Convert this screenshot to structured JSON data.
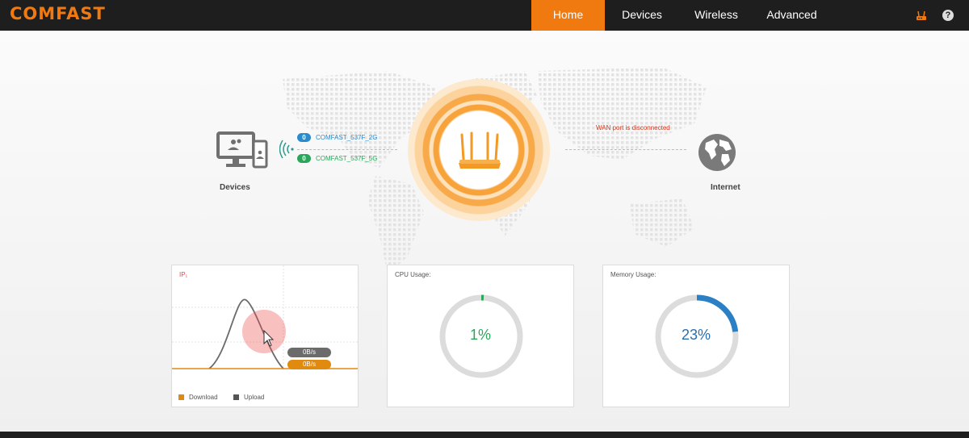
{
  "brand": {
    "logo_text": "COMFAST",
    "accent": "#f07a0f"
  },
  "nav": {
    "items": [
      {
        "label": "Home",
        "active": true
      },
      {
        "label": "Devices",
        "active": false
      },
      {
        "label": "Wireless",
        "active": false
      },
      {
        "label": "Advanced",
        "active": false
      }
    ],
    "icons": [
      "router-status-icon",
      "help-icon"
    ],
    "help_glyph": "?"
  },
  "topology": {
    "devices_label": "Devices",
    "ssids": [
      {
        "count": "0",
        "name": "COMFAST_537F_2G",
        "color": "#2b8acb"
      },
      {
        "count": "0",
        "name": "COMFAST_537F_5G",
        "color": "#2aa55a"
      }
    ],
    "wan_status": "WAN port is disconnected",
    "internet_label": "Internet"
  },
  "traffic": {
    "title": "IP₁",
    "upload_rate": "0B/s",
    "download_rate": "0B/s",
    "legend": [
      {
        "label": "Download",
        "color": "#e08a10"
      },
      {
        "label": "Upload",
        "color": "#555555"
      }
    ]
  },
  "cpu": {
    "title": "CPU Usage:",
    "value_text": "1%",
    "percent": 1,
    "color": "#2aa55a"
  },
  "memory": {
    "title": "Memory Usage:",
    "value_text": "23%",
    "percent": 23,
    "color": "#2b7fc4"
  }
}
